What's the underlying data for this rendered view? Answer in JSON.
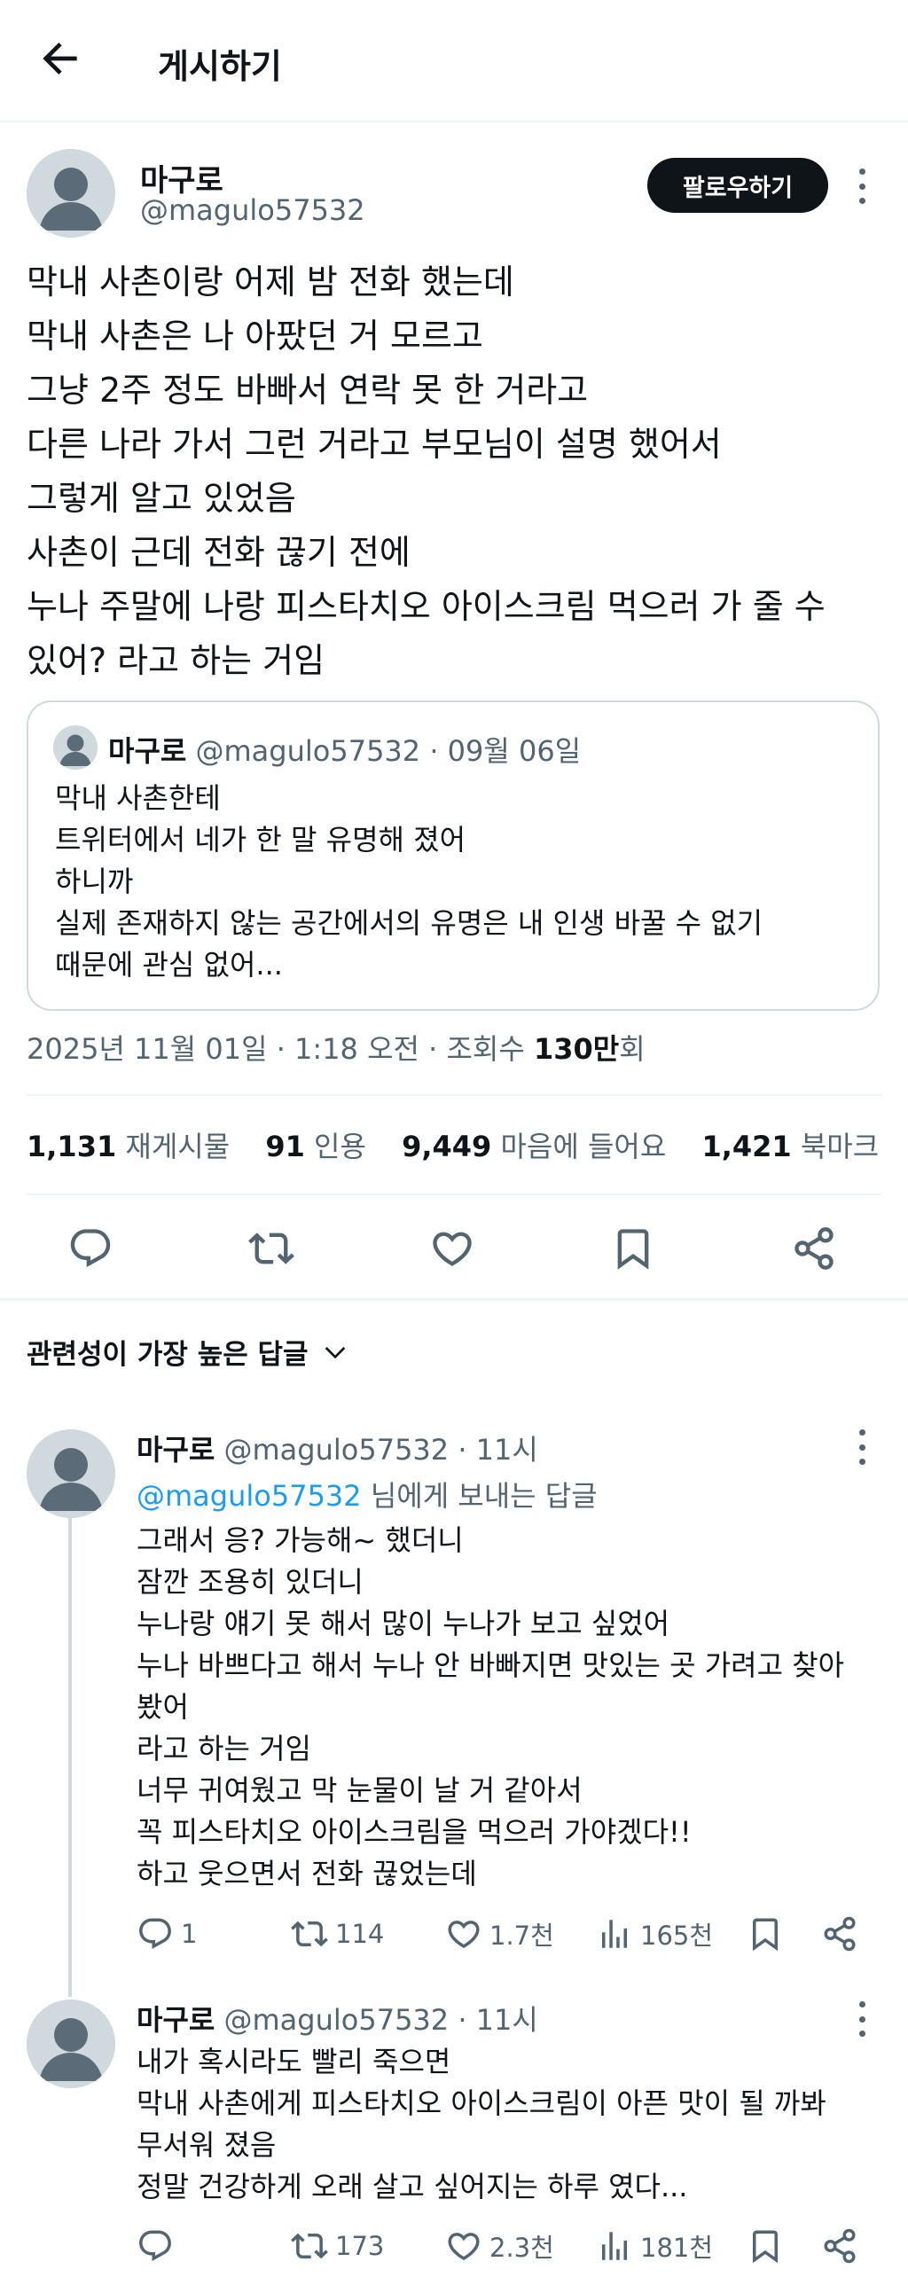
{
  "header": {
    "title": "게시하기"
  },
  "post": {
    "author_name": "마구로",
    "author_handle": "@magulo57532",
    "follow_label": "팔로우하기",
    "lines": [
      "막내 사촌이랑 어제 밤 전화 했는데",
      "막내 사촌은 나 아팠던 거 모르고",
      "그냥 2주 정도 바빠서 연락 못 한 거라고",
      "다른 나라 가서 그런 거라고 부모님이 설명 했어서",
      "그렇게 알고 있었음",
      "사촌이 근데 전화 끊기 전에",
      "누나 주말에 나랑 피스타치오 아이스크림 먹으러 가 줄 수",
      "있어? 라고 하는 거임"
    ],
    "quote": {
      "author_name": "마구로",
      "author_handle": "@magulo57532",
      "date": "· 09월 06일",
      "lines": [
        "막내 사촌한테",
        "트위터에서 네가 한 말 유명해 졌어",
        "하니까",
        "실제 존재하지 않는 공간에서의 유명은 내 인생 바꿀 수 없기",
        "때문에 관심 없어..."
      ]
    },
    "meta": {
      "timestamp": "2025년 11월 01일 · 1:18 오전 · 조회수 ",
      "views_number": "130만",
      "views_suffix": "회"
    },
    "stats": {
      "reposts_count": "1,131",
      "reposts_label": "재게시물",
      "quotes_count": "91",
      "quotes_label": "인용",
      "likes_count": "9,449",
      "likes_label": "마음에 들어요",
      "bookmarks_count": "1,421",
      "bookmarks_label": "북마크"
    }
  },
  "sort_label": "관련성이 가장 높은 답글",
  "replies": [
    {
      "author_name": "마구로",
      "author_handle": "@magulo57532 · 11시",
      "reply_to_handle": "@magulo57532",
      "reply_to_suffix": " 님에게 보내는 답글",
      "lines": [
        "그래서 응? 가능해~ 했더니",
        "잠깐 조용히 있더니",
        "누나랑 얘기 못 해서 많이 누나가 보고 싶었어",
        "누나 바쁘다고 해서 누나 안 바빠지면 맛있는 곳 가려고 찾아",
        "봤어",
        "라고 하는 거임",
        "너무 귀여웠고 막 눈물이 날 거 같아서",
        "꼭 피스타치오 아이스크림을 먹으러 가야겠다!!",
        "하고 웃으면서 전화 끊었는데"
      ],
      "replies_count": "1",
      "reposts_count": "114",
      "likes_count": "1.7천",
      "views_count": "165천"
    },
    {
      "author_name": "마구로",
      "author_handle": "@magulo57532 · 11시",
      "lines": [
        "내가 혹시라도 빨리 죽으면",
        "막내 사촌에게 피스타치오 아이스크림이 아픈 맛이 될 까봐",
        "무서워 졌음",
        "정말 건강하게 오래 살고 싶어지는 하루 였다..."
      ],
      "replies_count": "",
      "reposts_count": "173",
      "likes_count": "2.3천",
      "views_count": "181천"
    }
  ],
  "colors": {
    "text": "#0f1419",
    "muted": "#536471",
    "link": "#1d9bf0",
    "divider": "#eff3f4"
  },
  "icons": [
    "back-arrow-icon",
    "more-icon",
    "reply-icon",
    "repost-icon",
    "like-icon",
    "bookmark-icon",
    "share-icon",
    "views-icon",
    "chevron-down-icon",
    "default-avatar-icon"
  ]
}
